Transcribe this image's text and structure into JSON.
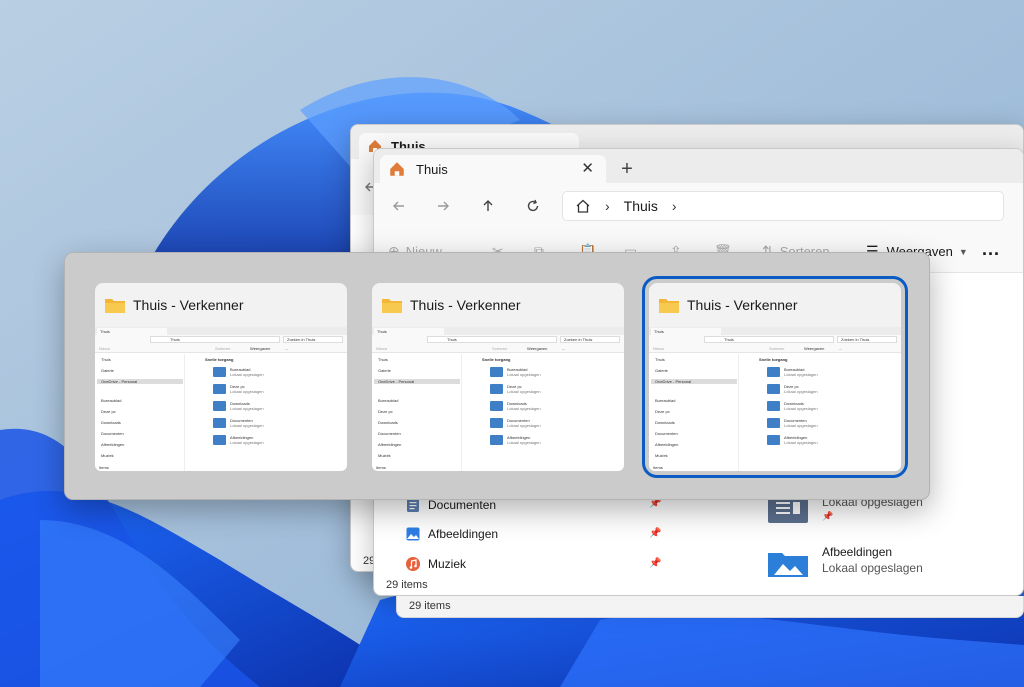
{
  "back_window": {
    "tab_title": "Thuis",
    "status": "29 items"
  },
  "front_window": {
    "tab_title": "Thuis",
    "breadcrumb": "Thuis",
    "toolbar": {
      "new_label": "Nieuw",
      "sort_label": "Sorteren",
      "view_label": "Weergaven",
      "more_label": "..."
    },
    "nav_items": [
      {
        "label": "Documenten",
        "icon": "documents-icon"
      },
      {
        "label": "Afbeeldingen",
        "icon": "pictures-icon"
      },
      {
        "label": "Muziek",
        "icon": "music-icon"
      }
    ],
    "content_items": [
      {
        "title": "",
        "subtitle": "Lokaal opgeslagen"
      },
      {
        "title": "Afbeeldingen",
        "subtitle": "Lokaal opgeslagen"
      }
    ],
    "status": "29 items"
  },
  "switcher": {
    "cards": [
      {
        "title": "Thuis - Verkenner",
        "selected": false
      },
      {
        "title": "Thuis - Verkenner",
        "selected": false
      },
      {
        "title": "Thuis - Verkenner",
        "selected": true
      }
    ],
    "thumb": {
      "tab": "Thuis",
      "crumb": "Thuis",
      "search": "Zoeken in Thuis",
      "new": "Nieuw",
      "sort": "Sorteren",
      "view": "Weergaven",
      "more": "...",
      "sidebar": [
        "Thuis",
        "Galerie",
        "OneDrive - Personal",
        "Bureaublad",
        "Deze pc",
        "Downloads",
        "Documenten",
        "Afbeeldingen",
        "Muziek"
      ],
      "section": "Snelle toegang",
      "items": [
        {
          "title": "Bureaublad",
          "sub": "Lokaal opgeslagen"
        },
        {
          "title": "Deze pc",
          "sub": "Lokaal opgeslagen"
        },
        {
          "title": "Downloads",
          "sub": "Lokaal opgeslagen"
        },
        {
          "title": "Documenten",
          "sub": "Lokaal opgeslagen"
        },
        {
          "title": "Afbeeldingen",
          "sub": "Lokaal opgeslagen"
        }
      ],
      "status": "Items"
    }
  },
  "colors": {
    "accent": "#0a5bc4",
    "folder": "#f3b637",
    "home": "#e07b39"
  }
}
